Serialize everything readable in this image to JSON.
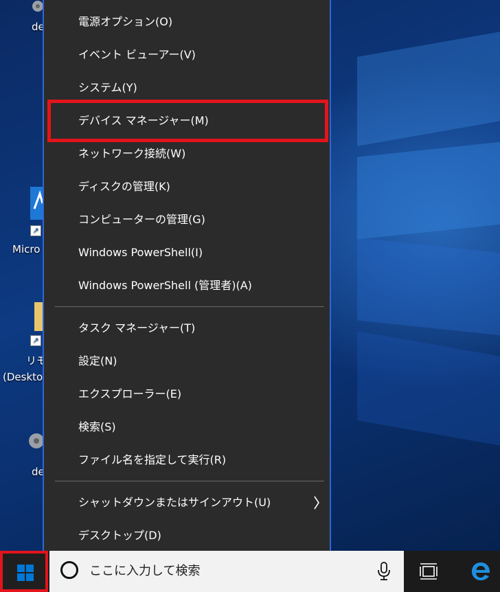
{
  "menu": {
    "items": [
      {
        "label": "電源オプション(O)"
      },
      {
        "label": "イベント ビューアー(V)"
      },
      {
        "label": "システム(Y)"
      },
      {
        "label": "デバイス マネージャー(M)"
      },
      {
        "label": "ネットワーク接続(W)"
      },
      {
        "label": "ディスクの管理(K)"
      },
      {
        "label": "コンピューターの管理(G)"
      },
      {
        "label": "Windows PowerShell(I)"
      },
      {
        "label": "Windows PowerShell (管理者)(A)"
      },
      {
        "label": "タスク マネージャー(T)"
      },
      {
        "label": "設定(N)"
      },
      {
        "label": "エクスプローラー(E)"
      },
      {
        "label": "検索(S)"
      },
      {
        "label": "ファイル名を指定して実行(R)"
      },
      {
        "label": "シャットダウンまたはサインアウト(U)"
      },
      {
        "label": "デスクトップ(D)"
      }
    ],
    "highlighted_item": "デバイス マネージャー(M)"
  },
  "desktop_icons": [
    {
      "label": "de",
      "icon": "gear-icon"
    },
    {
      "label": "Micro",
      "icon": "app-shortcut-icon"
    },
    {
      "label": "リモ",
      "label2": "(Deskto",
      "icon": "folder-shortcut-icon"
    },
    {
      "label": "de",
      "icon": "gear-icon"
    }
  ],
  "taskbar": {
    "search_placeholder": "ここに入力して検索",
    "icons": [
      "windows-logo-icon",
      "search-circle-icon",
      "microphone-icon",
      "task-view-icon",
      "edge-icon"
    ]
  },
  "colors": {
    "menu_bg": "#2b2b2b",
    "menu_border": "#2f66d8",
    "highlight": "#e3141b",
    "taskbar_bg": "#1b1b1b",
    "windows_blue": "#0078d7"
  }
}
